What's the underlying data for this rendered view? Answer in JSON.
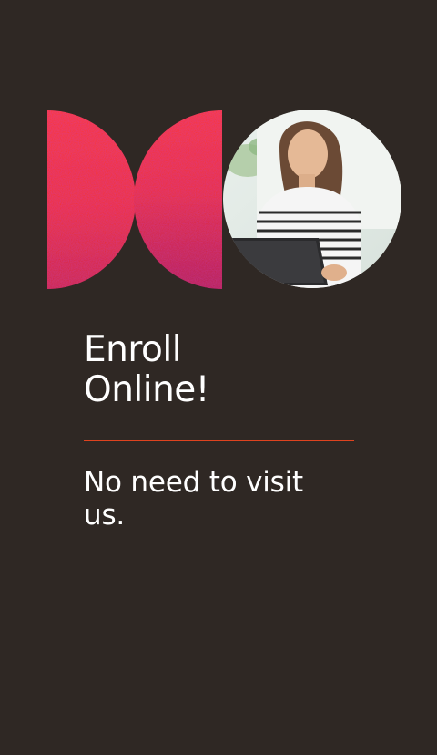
{
  "promo": {
    "headline_line1": "Enroll",
    "headline_line2": "Online!",
    "subheadline_line1": "No need to visit",
    "subheadline_line2": "us."
  },
  "colors": {
    "background": "#2f2824",
    "accent": "#e0431f",
    "text": "#ffffff"
  },
  "icons": {
    "logo_mark": "half-circle-pair-logo",
    "photo": "woman-using-tablet-photo"
  }
}
